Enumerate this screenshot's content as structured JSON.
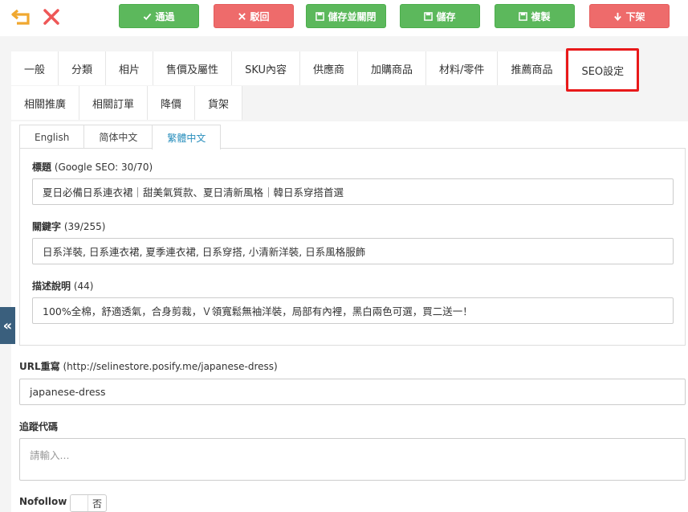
{
  "toolbar": {
    "approve_label": "通過",
    "reject_label": "駁回",
    "save_close_label": "儲存並關閉",
    "save_label": "儲存",
    "copy_label": "複製",
    "unpublish_label": "下架"
  },
  "tabs_row1": [
    "一般",
    "分類",
    "相片",
    "售價及屬性",
    "SKU內容",
    "供應商",
    "加購商品",
    "材料/零件",
    "推薦商品",
    "SEO設定"
  ],
  "tabs_row2": [
    "相關推廣",
    "相關訂單",
    "降價",
    "貨架"
  ],
  "lang_tabs": [
    "English",
    "简体中文",
    "繁體中文"
  ],
  "seo": {
    "title_label": "標題",
    "title_note": "(Google SEO: 30/70)",
    "title_value": "夏日必備日系連衣裙｜甜美氣質款、夏日清新風格｜韓日系穿搭首選",
    "keywords_label": "關鍵字",
    "keywords_note": "(39/255)",
    "keywords_value": "日系洋裝, 日系連衣裙, 夏季連衣裙, 日系穿搭, 小清新洋裝, 日系風格服飾",
    "desc_label": "描述說明",
    "desc_note": "(44)",
    "desc_value": "100%全棉，舒適透氣，合身剪裁，Ｖ領寬鬆無袖洋裝，局部有內裡，黑白兩色可選，買二送一！"
  },
  "url": {
    "label": "URL重寫",
    "note": "(http://selinestore.posify.me/japanese-dress)",
    "value": "japanese-dress"
  },
  "tracking": {
    "label": "追蹤代碼",
    "placeholder": "請輸入..."
  },
  "nofollow": {
    "label": "Nofollow",
    "toggle_text": "否"
  },
  "collapse_glyph": "«"
}
